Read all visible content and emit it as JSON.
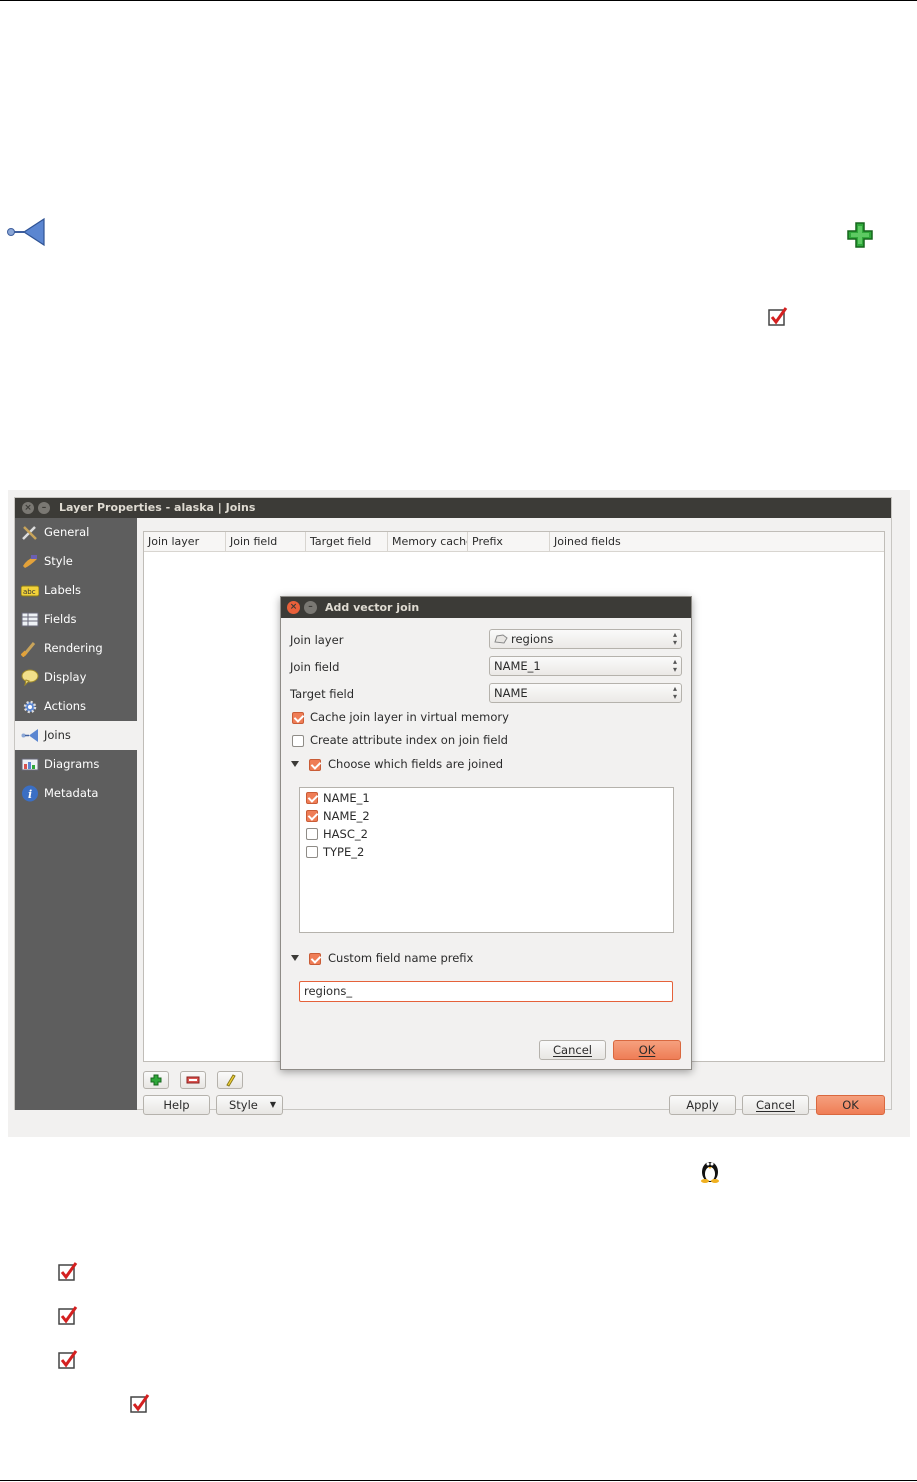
{
  "window": {
    "title": "Layer Properties - alaska | Joins"
  },
  "sidebar": {
    "items": [
      {
        "label": "General",
        "icon": "general-tools-icon"
      },
      {
        "label": "Style",
        "icon": "style-brush-icon"
      },
      {
        "label": "Labels",
        "icon": "labels-abc-icon"
      },
      {
        "label": "Fields",
        "icon": "fields-table-icon"
      },
      {
        "label": "Rendering",
        "icon": "rendering-brush-icon"
      },
      {
        "label": "Display",
        "icon": "display-balloon-icon"
      },
      {
        "label": "Actions",
        "icon": "actions-gear-icon"
      },
      {
        "label": "Joins",
        "icon": "joins-icon"
      },
      {
        "label": "Diagrams",
        "icon": "diagrams-icon"
      },
      {
        "label": "Metadata",
        "icon": "metadata-info-icon"
      }
    ],
    "active": "Joins"
  },
  "joins_table": {
    "columns": [
      "Join layer",
      "Join field",
      "Target field",
      "Memory cache",
      "Prefix",
      "Joined fields"
    ]
  },
  "bottom_bar": {
    "help": "Help",
    "style": "Style",
    "apply": "Apply",
    "cancel": "Cancel",
    "ok": "OK"
  },
  "dialog": {
    "title": "Add vector join",
    "join_layer_label": "Join layer",
    "join_layer_value": "regions",
    "join_field_label": "Join field",
    "join_field_value": "NAME_1",
    "target_field_label": "Target field",
    "target_field_value": "NAME",
    "cache_label": "Cache join layer in virtual memory",
    "cache_checked": true,
    "index_label": "Create attribute index on join field",
    "index_checked": false,
    "choose_fields_label": "Choose which fields are joined",
    "choose_fields_checked": true,
    "fields": [
      {
        "name": "NAME_1",
        "checked": true
      },
      {
        "name": "NAME_2",
        "checked": true
      },
      {
        "name": "HASC_2",
        "checked": false
      },
      {
        "name": "TYPE_2",
        "checked": false
      }
    ],
    "prefix_toggle_label": "Custom field name prefix",
    "prefix_toggle_checked": true,
    "prefix_value": "regions_",
    "cancel": "Cancel",
    "ok": "OK"
  },
  "colors": {
    "accent": "#ef7d56",
    "titlebar": "#3c3b37",
    "sidebar": "#5e5e5e"
  }
}
